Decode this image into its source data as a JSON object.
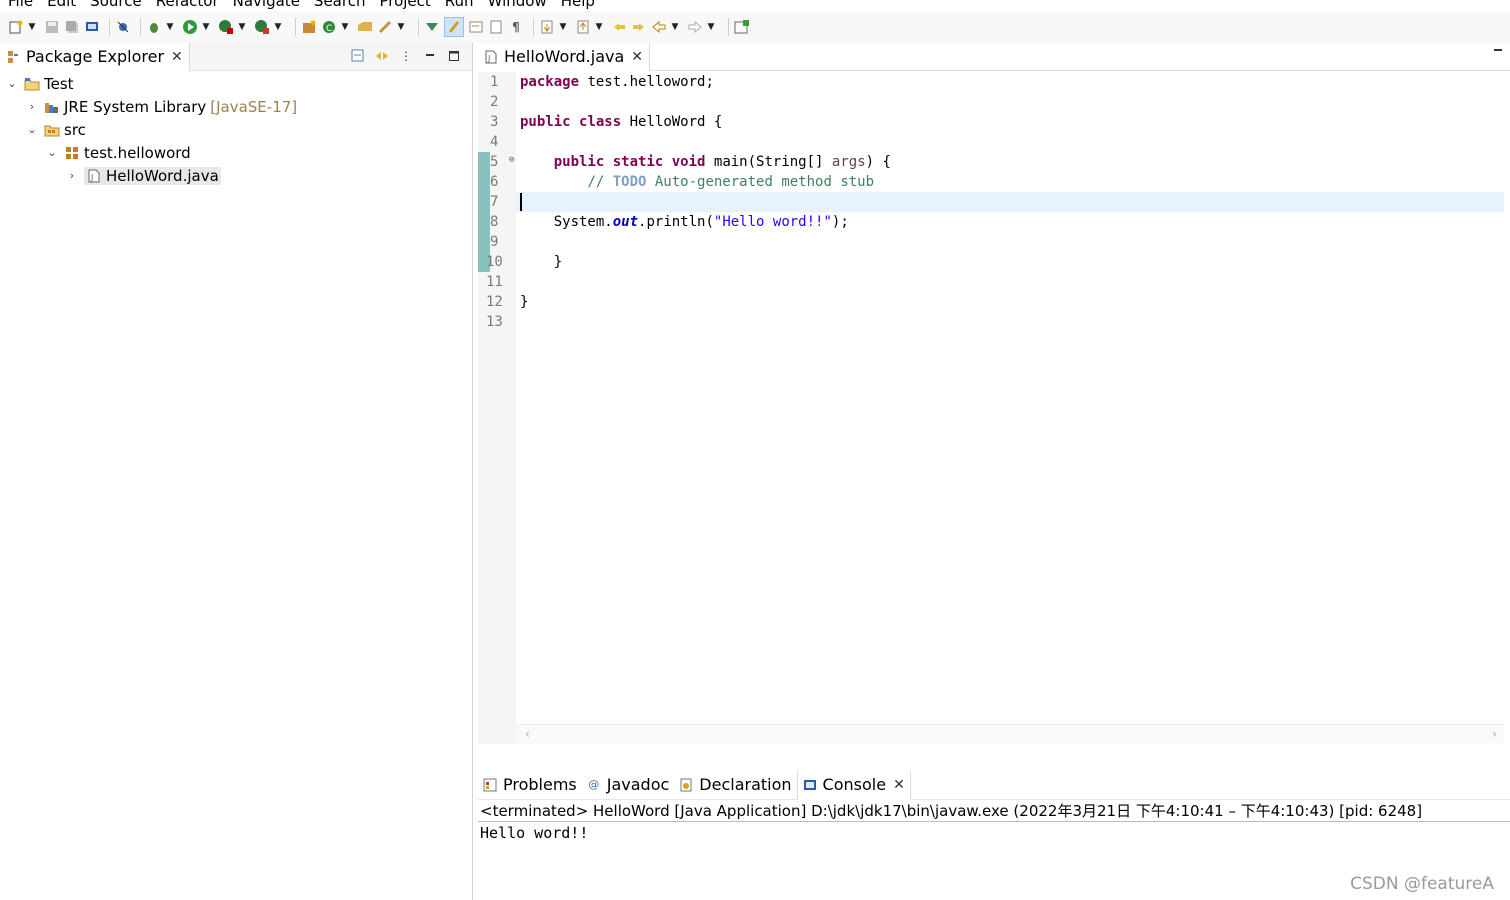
{
  "menu": [
    "File",
    "Edit",
    "Source",
    "Refactor",
    "Navigate",
    "Search",
    "Project",
    "Run",
    "Window",
    "Help"
  ],
  "package_explorer": {
    "tab_label": "Package Explorer",
    "tree": {
      "project": "Test",
      "jre": "JRE System Library",
      "jre_version": "[JavaSE-17]",
      "src": "src",
      "package": "test.helloword",
      "file": "HelloWord.java"
    }
  },
  "editor": {
    "tab_label": "HelloWord.java",
    "line_numbers": [
      "1",
      "2",
      "3",
      "4",
      "5",
      "6",
      "7",
      "8",
      "9",
      "10",
      "11",
      "12",
      "13"
    ],
    "code": {
      "l1_kw": "package",
      "l1_rest": " test.helloword;",
      "l3_kw1": "public",
      "l3_kw2": "class",
      "l3_rest": " HelloWord {",
      "l5_kw1": "public",
      "l5_kw2": "static",
      "l5_kw3": "void",
      "l5_a": " main(String[] ",
      "l5_param": "args",
      "l5_b": ") {",
      "l6_slash": "// ",
      "l6_todo": "TODO",
      "l6_rest": " Auto-generated method stub",
      "l8_a": "System.",
      "l8_field": "out",
      "l8_b": ".println(",
      "l8_str": "\"Hello word!!\"",
      "l8_c": ");",
      "l10": "}",
      "l12": "}"
    }
  },
  "console": {
    "tabs": {
      "problems": "Problems",
      "javadoc": "Javadoc",
      "declaration": "Declaration",
      "console": "Console"
    },
    "status": "<terminated> HelloWord [Java Application] D:\\jdk\\jdk17\\bin\\javaw.exe  (2022年3月21日 下午4:10:41 – 下午4:10:43) [pid: 6248]",
    "output": "Hello word!!"
  },
  "watermark": "CSDN @featureA"
}
